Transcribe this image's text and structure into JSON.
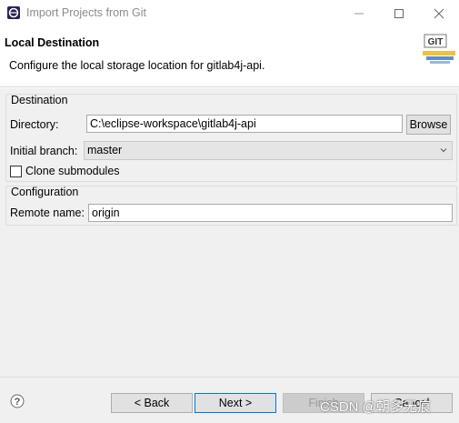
{
  "window": {
    "title": "Import Projects from Git",
    "controls": [
      "minimize-icon",
      "maximize-icon",
      "close-icon"
    ]
  },
  "header": {
    "title": "Local Destination",
    "description": "Configure the local storage location for gitlab4j-api.",
    "banner_text": "GIT"
  },
  "destination": {
    "group_label": "Destination",
    "directory_label": "Directory:",
    "directory_value": "C:\\eclipse-workspace\\gitlab4j-api",
    "browse_label": "Browse",
    "branch_label": "Initial branch:",
    "branch_value": "master",
    "clone_submodules_label": "Clone submodules",
    "clone_submodules_checked": false
  },
  "configuration": {
    "group_label": "Configuration",
    "remote_name_label": "Remote name:",
    "remote_name_value": "origin"
  },
  "footer": {
    "help_icon": "help-icon",
    "back_label": "< Back",
    "next_label": "Next >",
    "finish_label": "Finish",
    "cancel_label": "Cancel"
  },
  "watermark": "CSDN @朝多无痕"
}
